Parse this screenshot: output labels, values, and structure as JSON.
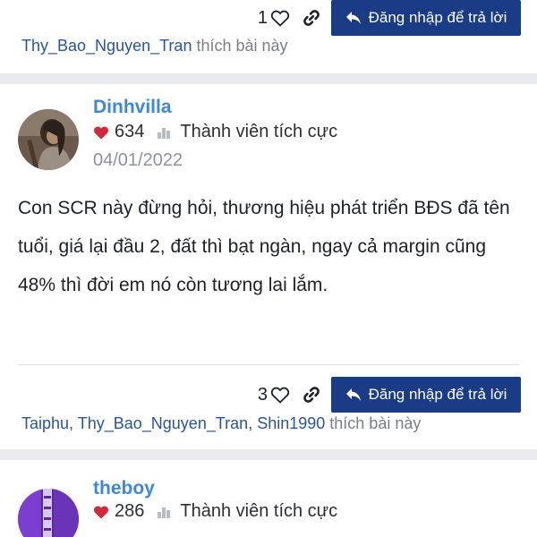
{
  "colors": {
    "brand_blue": "#1a3b86",
    "username_blue": "#3e88d8",
    "link_blue": "#2a5599",
    "heart_red": "#d12b3b",
    "muted": "#8f949b",
    "background": "#e9ebee"
  },
  "icons": {
    "heart": "heart-outline-icon",
    "link": "link-icon",
    "reply": "reply-arrow-icon",
    "reputation": "heart-filled-icon",
    "rank": "rank-icon"
  },
  "posts": [
    {
      "like_count": "1",
      "login_reply_label": "Đăng nhập để trả lời",
      "likers": [
        "Thy_Bao_Nguyen_Tran"
      ],
      "likes_suffix": " thích bài này"
    },
    {
      "username": "Dinhvilla",
      "reputation": "634",
      "rank": "Thành viên tích cực",
      "date": "04/01/2022",
      "body": "Con SCR này đừng hỏi, thương hiệu phát triển BĐS đã tên tuổi, giá lại đầu 2, đất thì bạt ngàn, ngay cả margin cũng 48% thì đời em nó còn tương lai lắm.",
      "like_count": "3",
      "login_reply_label": "Đăng nhập để trả lời",
      "likers": [
        "Taiphu",
        "Thy_Bao_Nguyen_Tran",
        "Shin1990"
      ],
      "likers_separator": ", ",
      "likes_suffix": " thích bài này"
    },
    {
      "username": "theboy",
      "reputation": "286",
      "rank": "Thành viên tích cực"
    }
  ]
}
